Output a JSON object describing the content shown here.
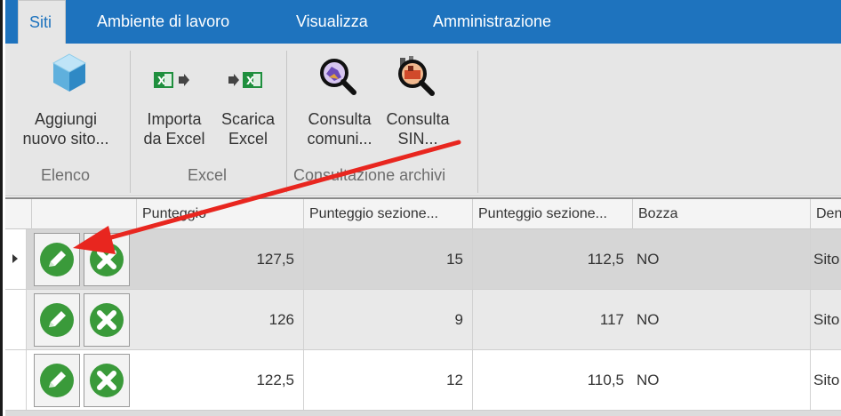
{
  "tabs": [
    {
      "label": "Siti",
      "active": true
    },
    {
      "label": "Ambiente di lavoro",
      "active": false
    },
    {
      "label": "Visualizza",
      "active": false
    },
    {
      "label": "Amministrazione",
      "active": false
    }
  ],
  "ribbon": {
    "groups": [
      {
        "label": "Elenco",
        "buttons": [
          {
            "line1": "Aggiungi",
            "line2": "nuovo sito...",
            "icon": "cube-icon"
          }
        ]
      },
      {
        "label": "Excel",
        "buttons": [
          {
            "line1": "Importa",
            "line2": "da Excel",
            "icon": "excel-import-icon"
          },
          {
            "line1": "Scarica",
            "line2": "Excel",
            "icon": "excel-export-icon"
          }
        ]
      },
      {
        "label": "Consultazione archivi",
        "buttons": [
          {
            "line1": "Consulta",
            "line2": "comuni...",
            "icon": "search-map-icon"
          },
          {
            "line1": "Consulta",
            "line2": "SIN...",
            "icon": "search-sin-icon"
          }
        ]
      }
    ]
  },
  "grid": {
    "columns": [
      "",
      "Punteggio",
      "Punteggio sezione...",
      "Punteggio sezione...",
      "Bozza",
      "Den"
    ],
    "rows": [
      {
        "punteggio": "127,5",
        "sez1": "15",
        "sez2": "112,5",
        "bozza": "NO",
        "den": "Sito",
        "selected": true
      },
      {
        "punteggio": "126",
        "sez1": "9",
        "sez2": "117",
        "bozza": "NO",
        "den": "Sito",
        "selected": false
      },
      {
        "punteggio": "122,5",
        "sez1": "12",
        "sez2": "110,5",
        "bozza": "NO",
        "den": "Sito",
        "selected": false
      }
    ]
  },
  "colors": {
    "tabbar": "#1e73be",
    "ribbon": "#e6e6e6",
    "selected_row": "#d6d6d6",
    "alt_row": "#e9e9e9",
    "arrow": "#e8261f",
    "edit_green": "#3a9a3a"
  }
}
